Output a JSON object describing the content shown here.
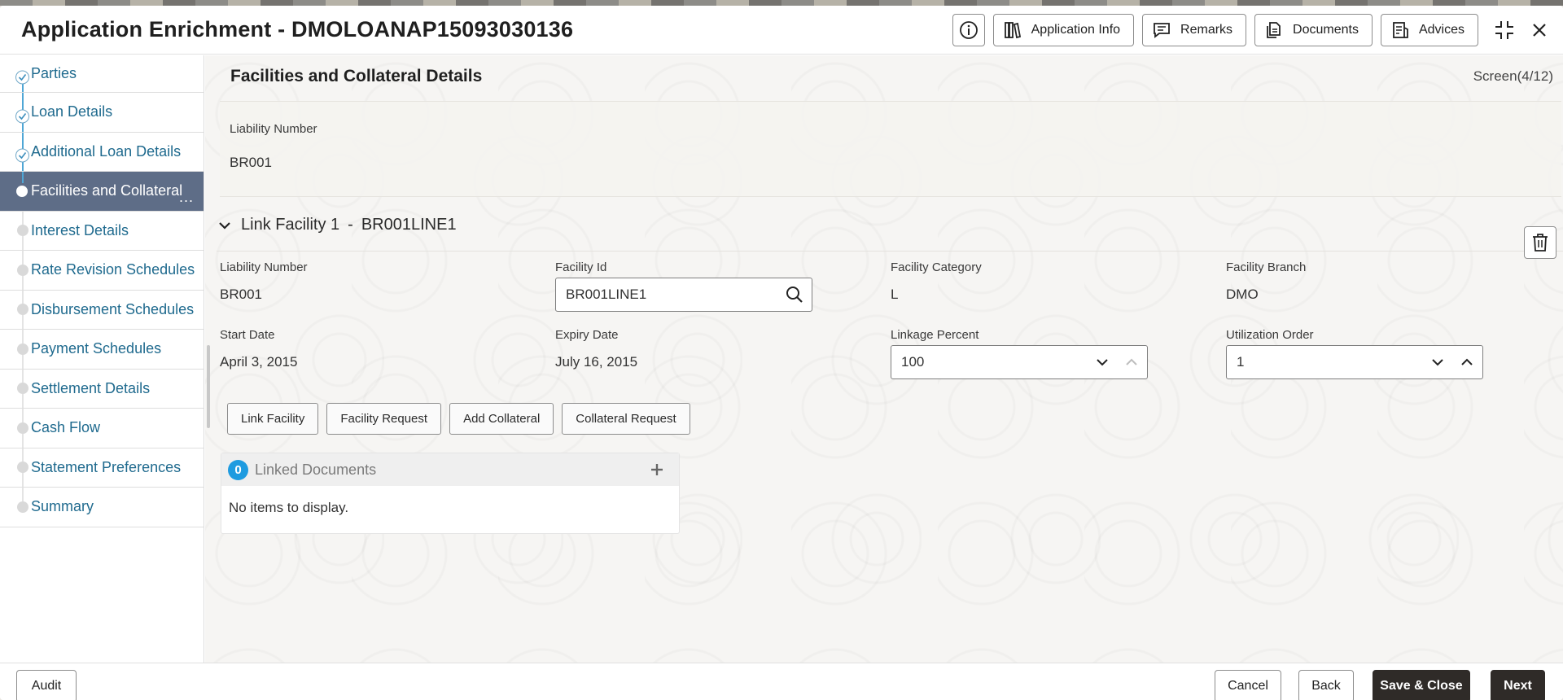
{
  "app": {
    "title": "Application Enrichment - DMOLOANAP15093030136"
  },
  "header": {
    "info_icon": "info-circle-icon",
    "buttons": [
      {
        "label": "Application Info",
        "icon": "books-icon"
      },
      {
        "label": "Remarks",
        "icon": "message-icon"
      },
      {
        "label": "Documents",
        "icon": "documents-icon"
      },
      {
        "label": "Advices",
        "icon": "advices-icon"
      }
    ],
    "collapse_icon": "collapse-icon",
    "close_icon": "close-icon"
  },
  "sidebar": {
    "items": [
      {
        "label": "Parties",
        "state": "done"
      },
      {
        "label": "Loan Details",
        "state": "done"
      },
      {
        "label": "Additional Loan Details",
        "state": "done"
      },
      {
        "label": "Facilities and Collateral",
        "state": "active"
      },
      {
        "label": "Interest Details",
        "state": "pending"
      },
      {
        "label": "Rate Revision Schedules",
        "state": "pending"
      },
      {
        "label": "Disbursement Schedules",
        "state": "pending"
      },
      {
        "label": "Payment Schedules",
        "state": "pending"
      },
      {
        "label": "Settlement Details",
        "state": "pending"
      },
      {
        "label": "Cash Flow",
        "state": "pending"
      },
      {
        "label": "Statement Preferences",
        "state": "pending"
      },
      {
        "label": "Summary",
        "state": "pending"
      }
    ],
    "active_ellipsis": "..."
  },
  "main": {
    "title": "Facilities and Collateral Details",
    "screen_counter": "Screen(4/12)",
    "liability": {
      "label": "Liability Number",
      "value": "BR001"
    },
    "link_facility": {
      "heading": "Link Facility 1",
      "separator": "-",
      "facility_code": "BR001LINE1",
      "fields": {
        "liability_number": {
          "label": "Liability Number",
          "value": "BR001"
        },
        "facility_id": {
          "label": "Facility Id",
          "value": "BR001LINE1"
        },
        "facility_category": {
          "label": "Facility Category",
          "value": "L"
        },
        "facility_branch": {
          "label": "Facility Branch",
          "value": "DMO"
        },
        "start_date": {
          "label": "Start Date",
          "value": "April 3, 2015"
        },
        "expiry_date": {
          "label": "Expiry Date",
          "value": "July 16, 2015"
        },
        "linkage_percent": {
          "label": "Linkage Percent",
          "value": "100"
        },
        "utilization_order": {
          "label": "Utilization Order",
          "value": "1"
        }
      },
      "actions": [
        "Link Facility",
        "Facility Request",
        "Add Collateral",
        "Collateral Request"
      ]
    },
    "linked_documents": {
      "count": "0",
      "title": "Linked Documents",
      "empty_text": "No items to display."
    }
  },
  "footer": {
    "audit": "Audit",
    "cancel": "Cancel",
    "back": "Back",
    "save_close": "Save & Close",
    "next": "Next"
  },
  "colors": {
    "accent_blue": "#1e9be0",
    "nav_text": "#1f6a8e",
    "active_nav_bg": "#5e6d87",
    "primary_dark": "#2f2b28"
  }
}
